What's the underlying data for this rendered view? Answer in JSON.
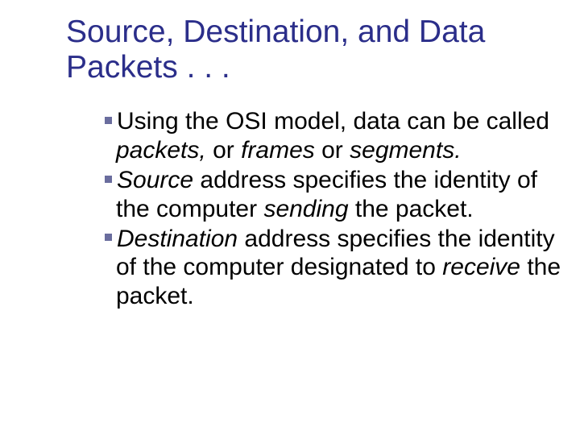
{
  "title": "Source, Destination, and Data Packets . . .",
  "bullets": [
    {
      "t1": "Using the OSI model, data can be called ",
      "i1": "packets,",
      "t2": " or ",
      "i2": "frames",
      "t3": " or ",
      "i3": "segments."
    },
    {
      "i1": "Source",
      "t1": " address specifies the identity of the computer ",
      "i2": "sending",
      "t2": " the packet."
    },
    {
      "i1": "Destination",
      "t1": " address specifies the identity of the computer designated to ",
      "i2": "receive",
      "t2": " the packet."
    }
  ]
}
